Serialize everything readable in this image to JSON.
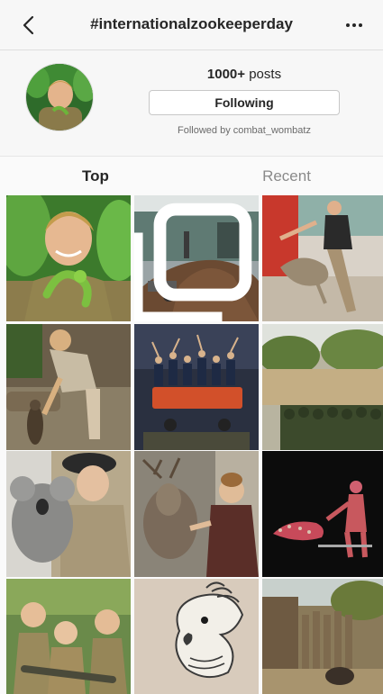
{
  "header": {
    "title": "#internationalzookeeperday"
  },
  "profile": {
    "post_count": "1000+",
    "post_unit": "posts",
    "follow_button_label": "Following",
    "followed_by": "Followed by combat_wombatz"
  },
  "tabs": [
    {
      "label": "Top",
      "active": true
    },
    {
      "label": "Recent",
      "active": false
    }
  ],
  "colors": {
    "text_primary": "#262626",
    "text_secondary": "#8a8a8a",
    "header_bg": "#f7f7f7"
  },
  "grid": {
    "posts": [
      {
        "description": "young man in khaki shirt with chameleon"
      },
      {
        "description": "zookeeper shoveling mulch pile with wheelbarrow",
        "multi_photo": true
      },
      {
        "description": "keeper with jumping kangaroo"
      },
      {
        "description": "keeper with meerkat on log"
      },
      {
        "description": "team of keepers cheering around orange cart"
      },
      {
        "description": "group of keepers in wildlife park"
      },
      {
        "description": "keeper holding koala"
      },
      {
        "description": "keeper with reindeer"
      },
      {
        "description": "illustration of keeper and animal on black"
      },
      {
        "description": "family in khaki with crocodile"
      },
      {
        "description": "drawing of white cockatoo"
      },
      {
        "description": "enclosure with fence and small animal"
      }
    ]
  }
}
